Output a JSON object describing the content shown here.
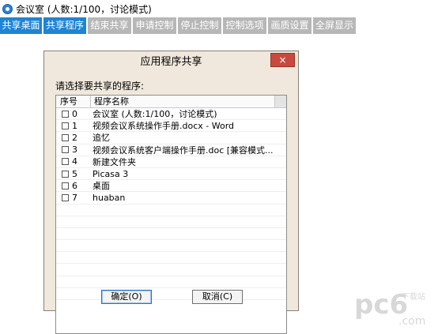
{
  "window": {
    "title": "会议室 (人数:1/100，讨论模式)"
  },
  "tabs": [
    {
      "label": "共享桌面",
      "state": "active"
    },
    {
      "label": "共享程序",
      "state": "active"
    },
    {
      "label": "结束共享",
      "state": "disabled"
    },
    {
      "label": "申请控制",
      "state": "disabled"
    },
    {
      "label": "停止控制",
      "state": "disabled"
    },
    {
      "label": "控制选项",
      "state": "disabled"
    },
    {
      "label": "画质设置",
      "state": "disabled"
    },
    {
      "label": "全屏显示",
      "state": "disabled"
    }
  ],
  "dialog": {
    "title": "应用程序共享",
    "close_label": "×",
    "prompt": "请选择要共享的程序:",
    "columns": {
      "num": "序号",
      "name": "程序名称"
    },
    "rows": [
      {
        "num": "0",
        "name": "会议室 (人数:1/100，讨论模式)"
      },
      {
        "num": "1",
        "name": "视频会议系统操作手册.docx - Word"
      },
      {
        "num": "2",
        "name": "追忆"
      },
      {
        "num": "3",
        "name": "视频会议系统客户端操作手册.doc [兼容模式..."
      },
      {
        "num": "4",
        "name": "新建文件夹"
      },
      {
        "num": "5",
        "name": "Picasa 3"
      },
      {
        "num": "6",
        "name": "桌面"
      },
      {
        "num": "7",
        "name": "huaban"
      }
    ],
    "ok_label": "确定(O)",
    "cancel_label": "取消(C)"
  },
  "watermark": {
    "text": "pc6",
    "sub": ".com",
    "tag": "下载站"
  },
  "colors": {
    "tab_active": "#1e84d4",
    "tab_disabled": "#b7b7b7",
    "dialog_bg": "#f0e8dc",
    "close_red": "#c84a3f"
  }
}
